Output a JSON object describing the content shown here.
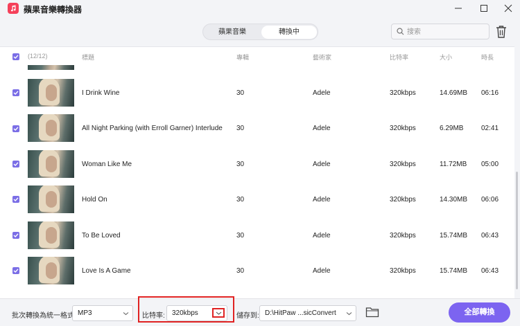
{
  "app": {
    "title": "蘋果音樂轉換器",
    "logo_icon": "music-note-icon",
    "accent_color": "#7b6ee6",
    "logo_color": "#f5405a"
  },
  "tabs": [
    {
      "label": "蘋果音樂",
      "active": false
    },
    {
      "label": "轉換中",
      "active": true
    }
  ],
  "search": {
    "placeholder": "搜索",
    "value": ""
  },
  "table": {
    "count": "(12/12)",
    "headers": {
      "title": "標題",
      "album": "專輯",
      "artist": "藝術家",
      "bitrate": "比特率",
      "size": "大小",
      "duration": "時長"
    },
    "rows": [
      {
        "title": "I Drink Wine",
        "album": "30",
        "artist": "Adele",
        "bitrate": "320kbps",
        "size": "14.69MB",
        "duration": "06:16",
        "checked": true
      },
      {
        "title": "All Night Parking (with Erroll Garner) Interlude",
        "album": "30",
        "artist": "Adele",
        "bitrate": "320kbps",
        "size": "6.29MB",
        "duration": "02:41",
        "checked": true
      },
      {
        "title": "Woman Like Me",
        "album": "30",
        "artist": "Adele",
        "bitrate": "320kbps",
        "size": "11.72MB",
        "duration": "05:00",
        "checked": true
      },
      {
        "title": "Hold On",
        "album": "30",
        "artist": "Adele",
        "bitrate": "320kbps",
        "size": "14.30MB",
        "duration": "06:06",
        "checked": true
      },
      {
        "title": "To Be Loved",
        "album": "30",
        "artist": "Adele",
        "bitrate": "320kbps",
        "size": "15.74MB",
        "duration": "06:43",
        "checked": true
      },
      {
        "title": "Love Is A Game",
        "album": "30",
        "artist": "Adele",
        "bitrate": "320kbps",
        "size": "15.74MB",
        "duration": "06:43",
        "checked": true
      }
    ]
  },
  "footer": {
    "format_label": "批次轉換為統一格式:",
    "format_value": "MP3",
    "bitrate_label": "比特率:",
    "bitrate_value": "320kbps",
    "save_label": "儲存到:",
    "save_value": "D:\\HitPaw ...sicConvert",
    "convert_all": "全部轉換"
  }
}
